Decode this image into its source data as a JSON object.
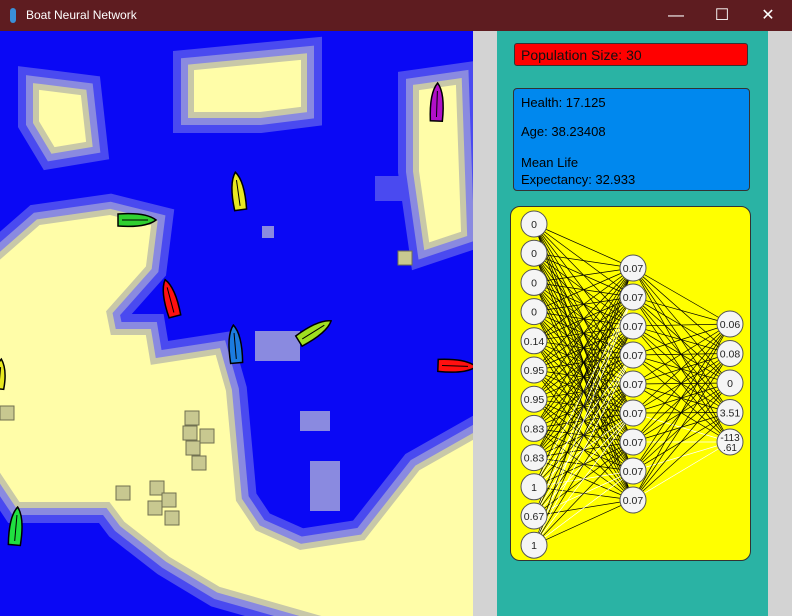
{
  "window": {
    "title": "Boat Neural Network",
    "minimize_glyph": "—",
    "maximize_glyph": "☐",
    "close_glyph": "✕",
    "title_bar_color": "#5e1c20"
  },
  "panel": {
    "population_label": "Population Size: 30",
    "health_label": "Health: 17.125",
    "age_label": "Age: 38.23408",
    "mean_life_line1": "Mean Life",
    "mean_life_line2": "Expectancy: 32.933",
    "colors": {
      "background": "#2ab3a4",
      "population_box": "#ff0000",
      "stats_box": "#0088ee",
      "network_box": "#ffff00"
    }
  },
  "network": {
    "inputs": [
      "0",
      "0",
      "0",
      "0",
      "0.14",
      "0.95",
      "0.95",
      "0.83",
      "0.83",
      "1",
      "0.67",
      "1"
    ],
    "hidden": [
      "0.07",
      "0.07",
      "0.07",
      "0.07",
      "0.07",
      "0.07",
      "0.07",
      "0.07",
      "0.07"
    ],
    "outputs": [
      "0.06",
      "0.08",
      "0",
      "3.51",
      "-113.61"
    ]
  },
  "game": {
    "water_color": "#0a08f5",
    "sand_color": "#fffda8",
    "boats": [
      {
        "color": "#e8e820",
        "icon": "boat-icon"
      },
      {
        "color": "#30d030",
        "icon": "boat-icon"
      },
      {
        "color": "#b010c8",
        "icon": "boat-icon"
      },
      {
        "color": "#ff1010",
        "icon": "boat-icon"
      },
      {
        "color": "#1c7ce0",
        "icon": "boat-icon"
      },
      {
        "color": "#a0e020",
        "icon": "boat-icon"
      },
      {
        "color": "#ff1010",
        "icon": "boat-icon"
      },
      {
        "color": "#20e040",
        "icon": "boat-icon"
      },
      {
        "color": "#e8e820",
        "icon": "boat-icon"
      }
    ]
  }
}
